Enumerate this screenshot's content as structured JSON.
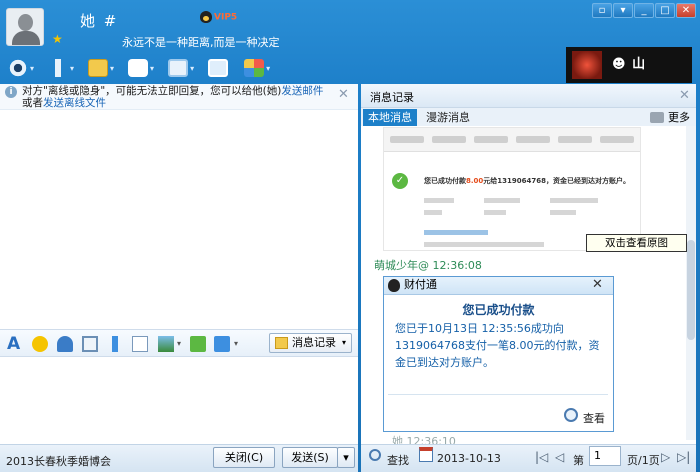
{
  "header": {
    "nickname": "她 #",
    "vip": "VIP5",
    "signature": "永远不是一种距离,而是一种决定"
  },
  "window_controls": [
    "▫",
    "▾",
    "_",
    "□",
    "✕"
  ],
  "notice": {
    "text1": "对方\"离线或隐身\"，可能无法立即回复，您可以给他(她)",
    "link1": "发送邮件",
    "text2": "或者",
    "link2": "发送离线文件"
  },
  "format_bar": {
    "history_label": "消息记录"
  },
  "bottom": {
    "expo_label": "2013长春秋季婚博会",
    "close_label": "关闭(C)",
    "send_label": "发送(S)"
  },
  "history": {
    "title": "消息记录",
    "tab_local": "本地消息",
    "tab_roaming": "漫游消息",
    "more": "更多",
    "screenshot_text": "您已成功付款",
    "screenshot_amount": "8.00",
    "screenshot_text2": "元给1319064768，资金已经到达对方账户。",
    "tooltip": "双击查看原图",
    "sender": "萌城少年@ 12:36:08",
    "card": {
      "title": "财付通",
      "heading": "您已成功付款",
      "body": "您已于10月13日 12:35:56成功向1319064768支付一笔8.00元的付款，资金已到达对方账户。",
      "view": "查看"
    },
    "cut_text": "她                    12:36:10",
    "search_label": "查找",
    "date": "2013-10-13",
    "page_label": "第",
    "page_value": "1",
    "page_total": "页/1页"
  },
  "colors": {
    "window_blue": "#1a73b8",
    "tab_active": "#1d80c9",
    "sender_green": "#2e8b57",
    "card_text": "#1560a8"
  }
}
